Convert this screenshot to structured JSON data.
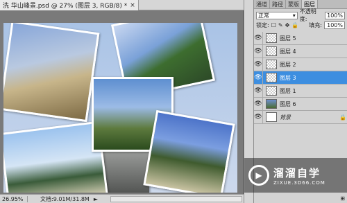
{
  "document": {
    "tab_title": "洗 华山峰景.psd @ 27% (图层 3, RGB/8) *",
    "close_glyph": "×"
  },
  "status": {
    "zoom": "26.95%",
    "doc_size": "文档:9.01M/31.8M",
    "arrow_glyph": "►"
  },
  "panel": {
    "tabs": [
      "通道",
      "路径",
      "蒙版",
      "图层"
    ],
    "active_tab_index": 3,
    "blend_mode": "正常",
    "blend_arrow": "▾",
    "opacity_label": "不透明度:",
    "opacity_value": "100%",
    "lock_label": "锁定:",
    "lock_icons": [
      "☐",
      "✎",
      "✥",
      "🔒"
    ],
    "fill_label": "填充:",
    "fill_value": "100%",
    "layers": [
      {
        "name": "图层 5",
        "thumb": "checker",
        "selected": false,
        "locked": false,
        "italic": false
      },
      {
        "name": "图层 4",
        "thumb": "checker",
        "selected": false,
        "locked": false,
        "italic": false
      },
      {
        "name": "图层 2",
        "thumb": "checker",
        "selected": false,
        "locked": false,
        "italic": false
      },
      {
        "name": "图层 3",
        "thumb": "checker",
        "selected": true,
        "locked": false,
        "italic": false
      },
      {
        "name": "图层 1",
        "thumb": "checker",
        "selected": false,
        "locked": false,
        "italic": false
      },
      {
        "name": "图层 6",
        "thumb": "image",
        "selected": false,
        "locked": false,
        "italic": false
      },
      {
        "name": "背景",
        "thumb": "white",
        "selected": false,
        "locked": true,
        "italic": true
      }
    ],
    "eye_glyph": "👁",
    "lock_glyph": "🔒",
    "footer_glyph": "⊞"
  },
  "watermark": {
    "title": "溜溜自学",
    "subtitle": "ZIXUE.3D66.COM",
    "logo_glyph": "▶"
  },
  "colors": {
    "selected_layer": "#3d8ee0",
    "panel_bg": "#d3d3d3",
    "workspace_bg": "#7a7a7a"
  }
}
